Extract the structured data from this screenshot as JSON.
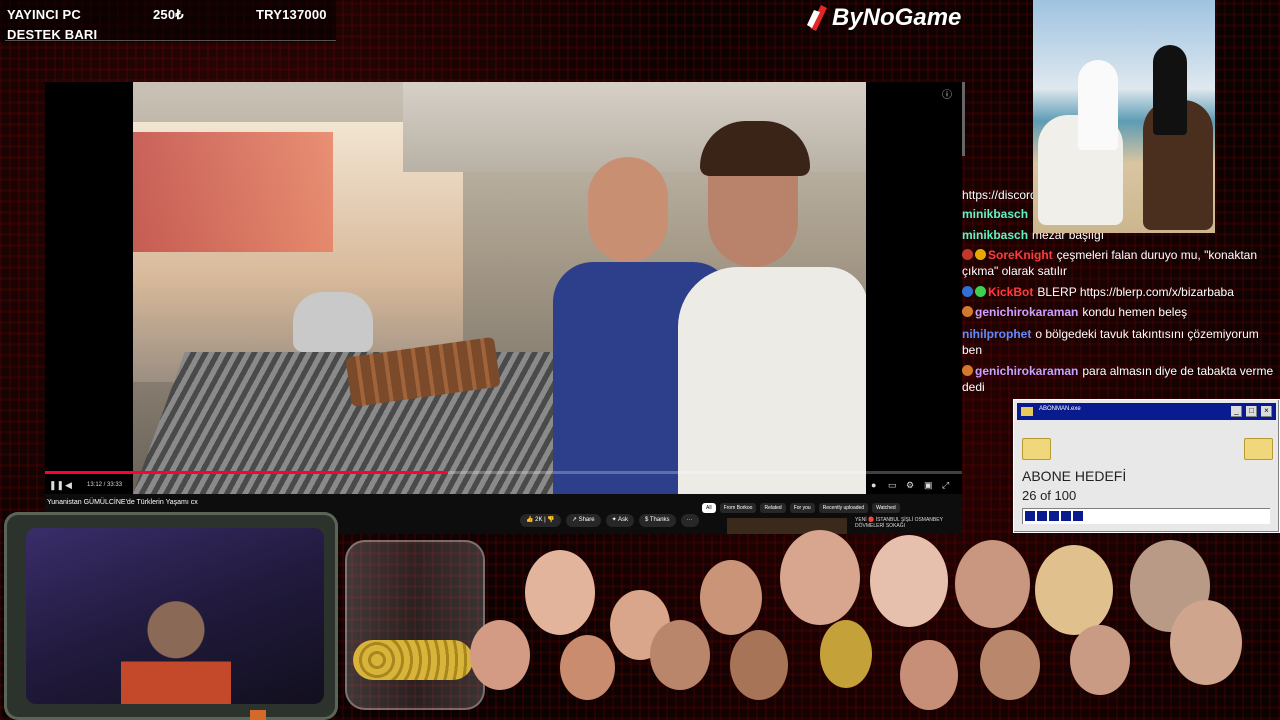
{
  "donation": {
    "line1": "YAYINCI PC",
    "line2": "DESTEK BARI",
    "current": "250₺",
    "goal": "TRY137000"
  },
  "brand": {
    "name": "ByNoGame"
  },
  "player": {
    "time": "13:12 / 33:33",
    "progress": 0.44,
    "title": "Yunanistan GÜMÜLCİNE'de Türklerin Yaşamı cx",
    "actions": {
      "likes": "2K",
      "share": "Share",
      "ask": "Ask",
      "thanks": "Thanks",
      "more": "···"
    },
    "chips": [
      "All",
      "From Borkoo",
      "Related",
      "For you",
      "Recently uploaded",
      "Watched"
    ],
    "rec_text": "YENİ 🔴 İSTANBUL ŞİŞLİ OSMANBEY DÖVMELERİ SOKAĞI"
  },
  "chat": [
    {
      "user": "",
      "text": "https://discord",
      "color": "#ffffff"
    },
    {
      "user": "minikbasch",
      "text": "",
      "color": "#5ff4c6"
    },
    {
      "user": "minikbasch",
      "text": "mezar başlığı",
      "color": "#5ff4c6"
    },
    {
      "user": "SoreKnight",
      "text": "çeşmeleri falan duruyo mu, \"konaktan çıkma\" olarak satılır",
      "color": "#ff3c3c",
      "badges": [
        "#c0392b",
        "#e8a800"
      ]
    },
    {
      "user": "KickBot",
      "text": "BLERP https://blerp.com/x/bizarbaba",
      "color": "#ff3c3c",
      "badges": [
        "#2f6fd8",
        "#3ecf4f"
      ]
    },
    {
      "user": "genichirokaraman",
      "text": "kondu hemen beleş",
      "color": "#c8a2ff",
      "badges": [
        "#d17a2f"
      ]
    },
    {
      "user": "nihilprophet",
      "text": "o bölgedeki tavuk takıntısını çözemiyorum ben",
      "color": "#5d8cff"
    },
    {
      "user": "genichirokaraman",
      "text": "para almasın diye de tabakta verme dedi",
      "color": "#c8a2ff",
      "badges": [
        "#d17a2f"
      ]
    }
  ],
  "sub_goal": {
    "window_title": "ABONMAN.exe",
    "label": "ABONE HEDEFİ",
    "count_text": "26 of 100",
    "current": 26,
    "target": 100
  },
  "colors": {
    "accent_red": "#ff0033",
    "win_blue": "#0a1a8f",
    "chat_bg": "#0b0202"
  }
}
